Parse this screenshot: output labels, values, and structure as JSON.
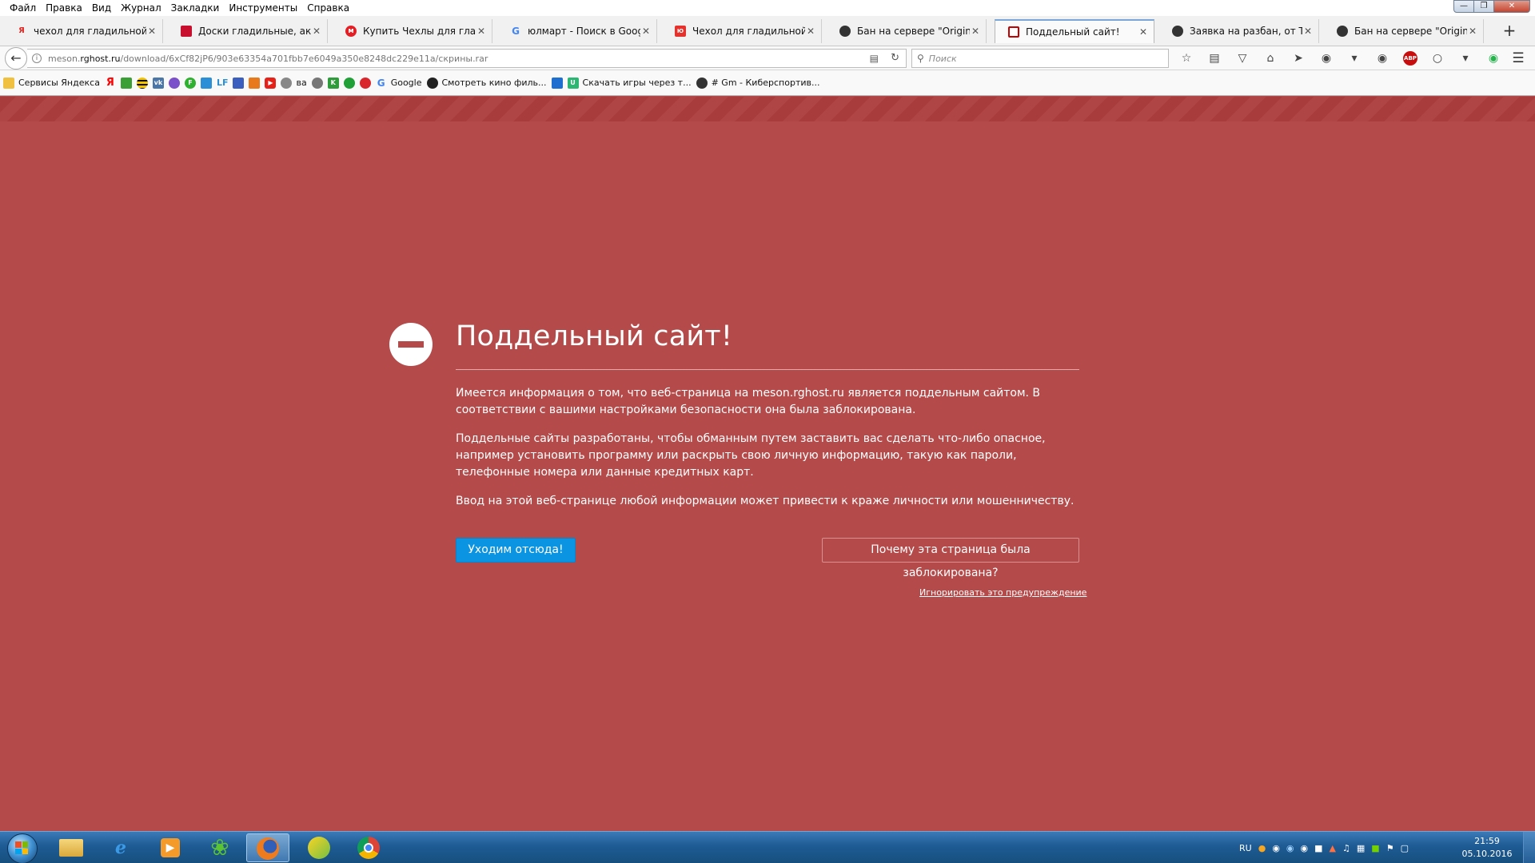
{
  "menu": [
    "Файл",
    "Правка",
    "Вид",
    "Журнал",
    "Закладки",
    "Инструменты",
    "Справка"
  ],
  "tabs": [
    {
      "label": "чехол для гладильной до...",
      "icon": "yandex-icon",
      "color": "#ffffff"
    },
    {
      "label": "Доски гладильные, аксес...",
      "icon": "store-icon",
      "color": "#c8102e"
    },
    {
      "label": "Купить Чехлы для гладил...",
      "icon": "store-icon",
      "color": "#e31e24"
    },
    {
      "label": "юлмарт - Поиск в Google",
      "icon": "google-icon",
      "color": "#4285f4"
    },
    {
      "label": "Чехол для гладильной до...",
      "icon": "store-icon",
      "color": "#e5322d"
    },
    {
      "label": "Бан на сервере \"Original ...",
      "icon": "globe-icon",
      "color": "#333333"
    },
    {
      "label": "Поддельный сайт!",
      "icon": "blocked-page-icon",
      "color": "#c40000"
    },
    {
      "label": "Заявка на разбан, от The ...",
      "icon": "globe-icon",
      "color": "#333333"
    },
    {
      "label": "Бан на сервере \"Original ...",
      "icon": "globe-icon",
      "color": "#333333"
    }
  ],
  "nav": {
    "url_prefix": "meson.",
    "url_domain": "rghost.ru",
    "url_path": "/download/6xCf82jP6/903e63354a701fbb7e6049a350e8248dc229e11a/скрины.rar",
    "search_placeholder": "Поиск"
  },
  "bookmarks": [
    {
      "label": "Сервисы Яндекса",
      "icon": "folder-icon",
      "color": "#f0c040"
    },
    {
      "label": "",
      "icon": "yandex-icon",
      "color": "#ff0000"
    },
    {
      "label": "",
      "icon": "bookmark-icon",
      "color": "#3aa035"
    },
    {
      "label": "",
      "icon": "beeline-icon",
      "color": "#f5c400"
    },
    {
      "label": "",
      "icon": "vk-icon",
      "color": "#4a76a8"
    },
    {
      "label": "",
      "icon": "bookmark-icon",
      "color": "#7b4fc9"
    },
    {
      "label": "",
      "icon": "bookmark-icon",
      "color": "#30b030"
    },
    {
      "label": "",
      "icon": "bookmark-icon",
      "color": "#2a8fd6"
    },
    {
      "label": "LF",
      "icon": "bookmark-icon",
      "color": "#2a8fd6"
    },
    {
      "label": "",
      "icon": "bookmark-icon",
      "color": "#3a5fbf"
    },
    {
      "label": "",
      "icon": "bookmark-icon",
      "color": "#e97a1c"
    },
    {
      "label": "",
      "icon": "youtube-icon",
      "color": "#e62117"
    },
    {
      "label": "ва",
      "icon": "globe-icon",
      "color": "#888888"
    },
    {
      "label": "",
      "icon": "globe-icon",
      "color": "#777777"
    },
    {
      "label": "",
      "icon": "bookmark-icon",
      "color": "#2f9c3c"
    },
    {
      "label": "",
      "icon": "bookmark-icon",
      "color": "#21a038"
    },
    {
      "label": "",
      "icon": "bookmark-icon",
      "color": "#d9262c"
    },
    {
      "label": "Google",
      "icon": "google-icon",
      "color": "#4285f4"
    },
    {
      "label": "Смотреть кино филь...",
      "icon": "bookmark-icon",
      "color": "#222222"
    },
    {
      "label": "",
      "icon": "bookmark-icon",
      "color": "#1e6fcf"
    },
    {
      "label": "Скачать игры через т...",
      "icon": "bookmark-icon",
      "color": "#2bb673"
    },
    {
      "label": "# Gm - Киберспортив...",
      "icon": "globe-icon",
      "color": "#333333"
    }
  ],
  "page": {
    "title": "Поддельный сайт!",
    "p1": "Имеется информация о том, что веб-страница на meson.rghost.ru является поддельным сайтом. В соответствии с вашими настройками безопасности она была заблокирована.",
    "p2": "Поддельные сайты разработаны, чтобы обманным путем заставить вас сделать что-либо опасное, например установить программу или раскрыть свою личную информацию, такую как пароли, телефонные номера или данные кредитных карт.",
    "p3": "Ввод на этой веб-странице любой информации может привести к краже личности или мошенничеству.",
    "leave_button": "Уходим отсюда!",
    "why_button": "Почему эта страница была заблокирована?",
    "ignore_link": "Игнорировать это предупреждение",
    "background_color": "#b44a4a",
    "primary_button_color": "#0b94e2"
  },
  "taskbar": {
    "apps": [
      {
        "name": "explorer-icon",
        "active": false
      },
      {
        "name": "internet-explorer-icon",
        "active": false
      },
      {
        "name": "media-player-icon",
        "active": false
      },
      {
        "name": "icq-icon",
        "active": false
      },
      {
        "name": "firefox-icon",
        "active": true
      },
      {
        "name": "game-launcher-icon",
        "active": false
      },
      {
        "name": "chrome-icon",
        "active": false
      }
    ],
    "lang": "RU",
    "time": "21:59",
    "date": "05.10.2016"
  }
}
